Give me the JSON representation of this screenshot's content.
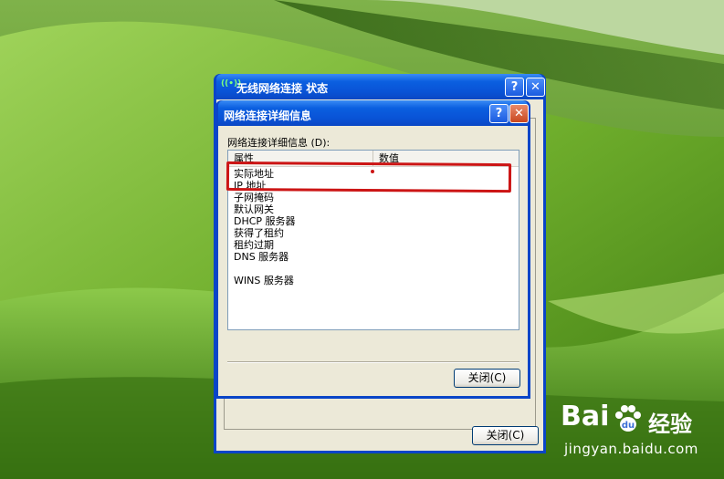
{
  "outer_window": {
    "title": "无线网络连接 状态",
    "help_label": "?",
    "close_label": "✕",
    "close_button": "关闭(C)"
  },
  "details_dialog": {
    "title": "网络连接详细信息",
    "help_label": "?",
    "close_label": "✕",
    "group_label": "网络连接详细信息 (D):",
    "columns": [
      "属性",
      "数值"
    ],
    "rows": [
      "实际地址",
      "IP 地址",
      "子网掩码",
      "默认网关",
      "DHCP 服务器",
      "获得了租约",
      "租约过期",
      "DNS 服务器",
      "",
      "WINS 服务器"
    ],
    "close_button": "关闭(C)"
  },
  "watermark": {
    "logo": "Bai",
    "logo_suffix": "经验",
    "url": "jingyan.baidu.com"
  },
  "colors": {
    "titlebar": "#0a47c4",
    "dialog_bg": "#ece9d8",
    "annotation": "#cc1515"
  }
}
